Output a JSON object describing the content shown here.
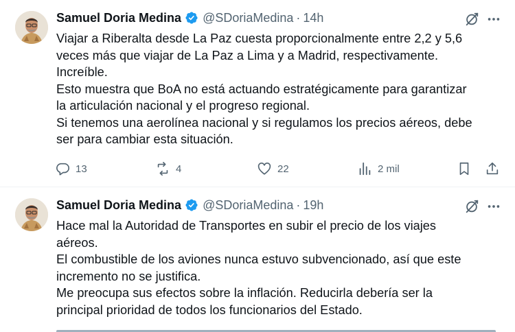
{
  "tweets": [
    {
      "author_name": "Samuel Doria Medina",
      "handle": "@SDoriaMedina",
      "separator": "·",
      "time": "14h",
      "lines": [
        "Viajar a Riberalta desde La Paz cuesta proporcionalmente entre 2,2 y 5,6",
        "veces más que viajar de La Paz a Lima y a Madrid, respectivamente.",
        "Increíble.",
        "Esto muestra que BoA no está actuando estratégicamente para garantizar",
        "la articulación nacional y el progreso regional.",
        "Si tenemos una aerolínea nacional y si regulamos los precios aéreos, debe",
        "ser para cambiar esta situación."
      ],
      "replies": "13",
      "reposts": "4",
      "likes": "22",
      "views": "2 mil"
    },
    {
      "author_name": "Samuel Doria Medina",
      "handle": "@SDoriaMedina",
      "separator": "·",
      "time": "19h",
      "lines": [
        "Hace mal la Autoridad de Transportes en subir el precio de los viajes",
        "aéreos.",
        "El combustible de los aviones nunca estuvo subvencionado, así que este",
        "incremento no se justifica.",
        "Me preocupa sus efectos sobre la inflación. Reducirla debería ser la",
        "principal prioridad de todos los funcionarios del Estado."
      ]
    }
  ],
  "colors": {
    "text": "#0f1419",
    "secondary": "#536471",
    "verified": "#1d9bf0",
    "divider": "#eff3f4"
  },
  "icons": [
    "verified-badge-icon",
    "grok-icon",
    "more-icon",
    "reply-icon",
    "repost-icon",
    "like-icon",
    "views-icon",
    "bookmark-icon",
    "share-icon"
  ]
}
